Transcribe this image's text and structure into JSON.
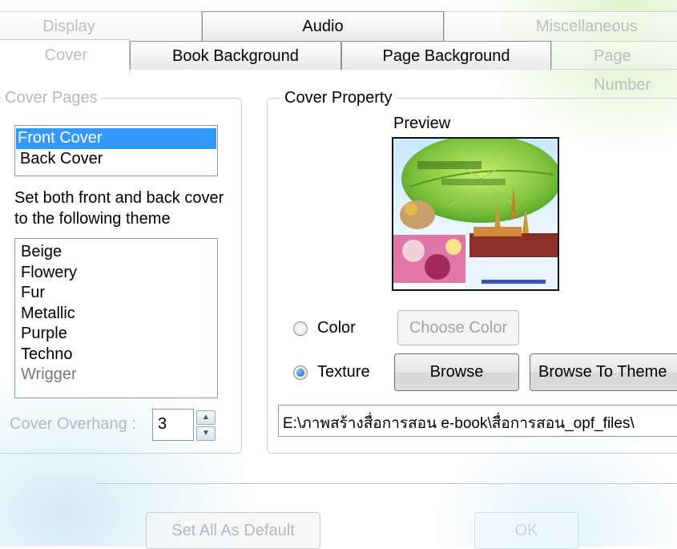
{
  "tabs_row1": [
    {
      "label": "Display",
      "state": "faded"
    },
    {
      "label": "Audio",
      "state": "normal"
    },
    {
      "label": "Miscellaneous",
      "state": "faded"
    }
  ],
  "tabs_row2": [
    {
      "label": "Cover",
      "state": "active"
    },
    {
      "label": "Book Background",
      "state": "normal"
    },
    {
      "label": "Page Background",
      "state": "normal"
    },
    {
      "label": "Page Number",
      "state": "faded"
    }
  ],
  "cover_pages": {
    "legend": "Cover Pages",
    "items": [
      "Front Cover",
      "Back Cover"
    ],
    "selected": "Front Cover",
    "theme_caption": "Set both front and back cover to the following theme",
    "themes": [
      "Beige",
      "Flowery",
      "Fur",
      "Metallic",
      "Purple",
      "Techno",
      "Wrigger"
    ],
    "overhang_label": "Cover Overhang :",
    "overhang_value": "3"
  },
  "cover_property": {
    "legend": "Cover Property",
    "preview_label": "Preview",
    "color_label": "Color",
    "choose_color_label": "Choose Color",
    "texture_label": "Texture",
    "browse_label": "Browse",
    "browse_theme_label": "Browse To Theme",
    "selected_option": "Texture",
    "path_value": "E:\\ภาพสร้างสื่อการสอน e-book\\สื่อการสอน_opf_files\\"
  },
  "footer": {
    "set_default_label": "Set All As Default",
    "ok_label": "OK"
  },
  "colors": {
    "selection": "#3399ff",
    "group_border": "#c9cfd6",
    "list_border": "#7f9db9"
  }
}
